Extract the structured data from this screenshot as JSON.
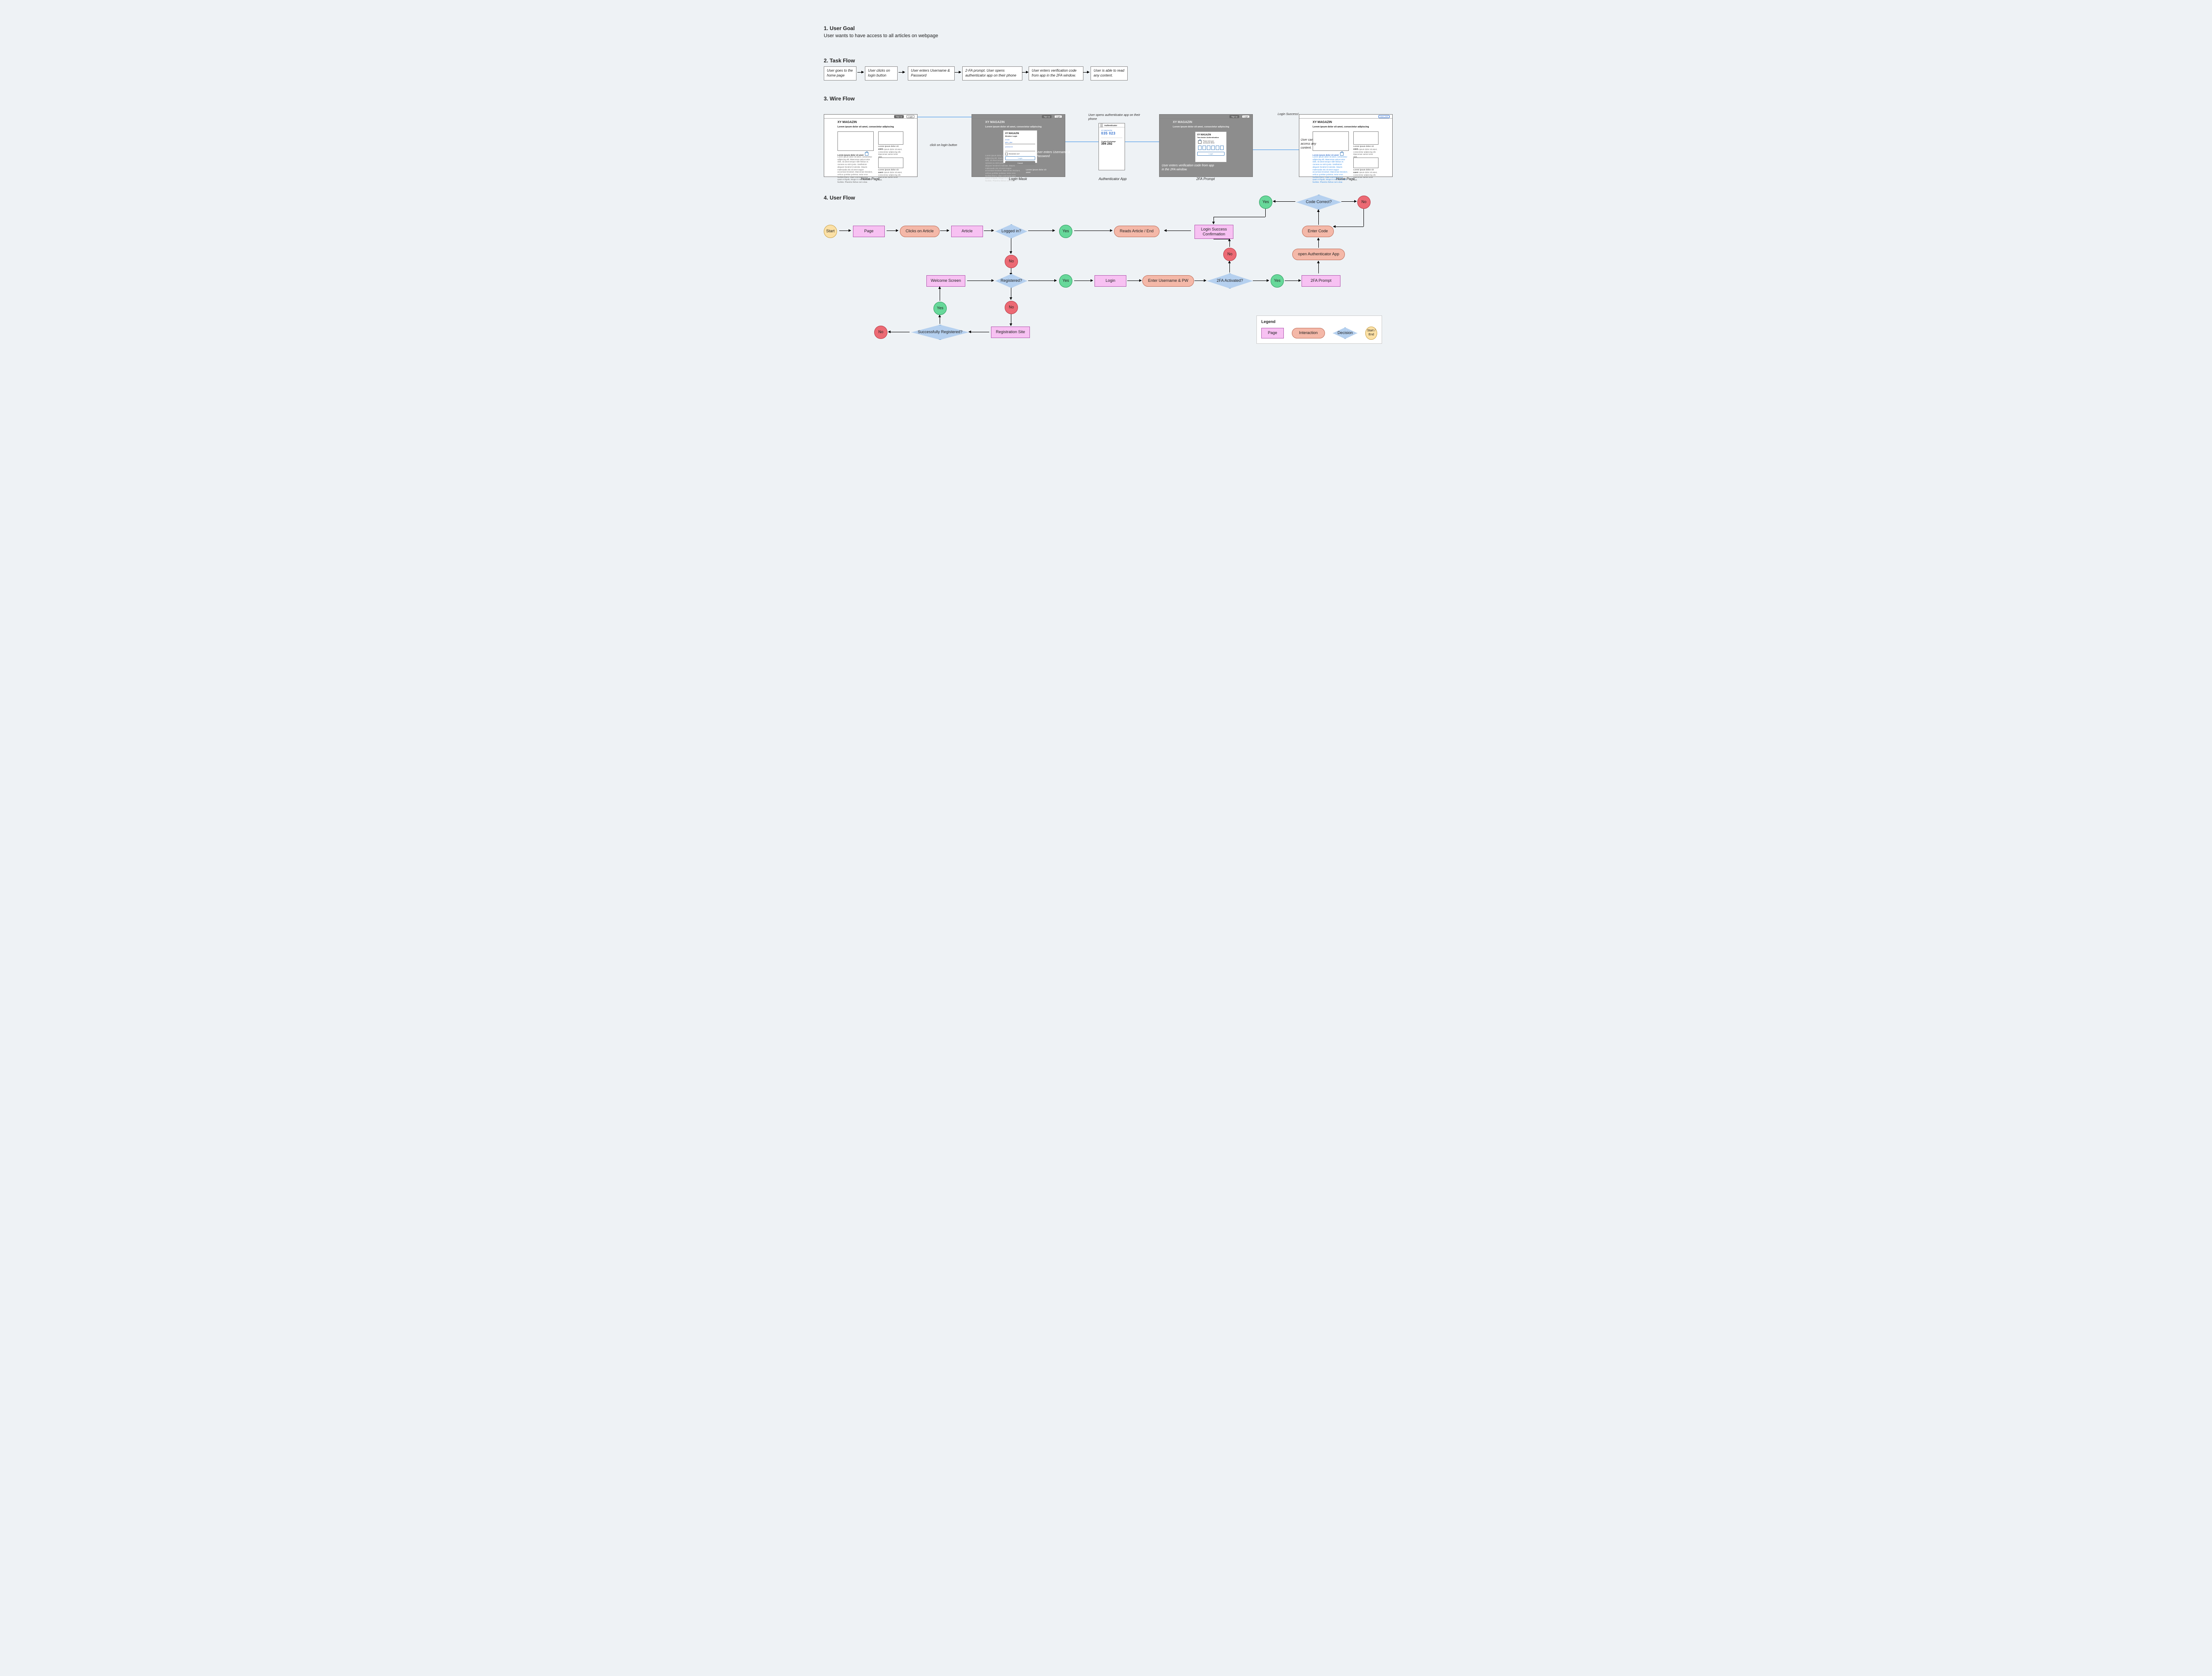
{
  "sections": {
    "s1_title": "1. User Goal",
    "s1_text": "User wants to have access to all articles on webpage",
    "s2_title": "2. Task Flow",
    "s3_title": "3. Wire Flow",
    "s4_title": "4. User Flow"
  },
  "task": {
    "t1": "User goes to the home page",
    "t2": "User clicks on login button",
    "t3": "User enters Username & Password",
    "t4": "2-FA prompt. User opens authenticator app on their phone",
    "t5": "User enters verification code from app in the 2FA window.",
    "t6": "User is able to read any content."
  },
  "wire": {
    "brand": "XY MAGAZIN",
    "headline": "Lorem ipsum dolor sit amet, consectetur adipiscing",
    "side_head": "Lorem ipsum dolor sit amet",
    "side_body": "Lorem ipsum dolor sit amet, consectetur adipiscing elit. Maecenas varius tortor nibh.",
    "locked_body": "Lorem ipsum dolor sit amet, consectetur adipiscing elit. Maecenas varius tortor nibh, sit amet tempor nibh finibus et. Aenean eu enim justo. Vestibulum aliquam hendrerit molestie. Mauris malesuada nisi sit amet augue accumsan tincidunt. Maecenas tincidunt, velit ac porttitor pulvinar, tortor eros facilisis libero, vitae commodo nunc quam et ligula, integer in nisi est iaculis facilisis. Pharetra finibus sem vitae.",
    "btn_signup": "Sign up",
    "btn_login": "Login",
    "login": {
      "title": "Member Login",
      "email_l": "email",
      "email_v": "john_doe",
      "pw_l": "password",
      "remember": "Remember me?",
      "login": "Login",
      "cancel": "Cancel"
    },
    "twofa": {
      "title": "Two-factor Authentication",
      "hint": "Please enter your accesscode below",
      "login": "Login"
    },
    "logged": {
      "user": "User_043"
    },
    "captions": {
      "c1": "Home Page",
      "c2": "Login Mask",
      "c3": "Authenticator App",
      "c4": "2FA Prompt",
      "c5": "Home Page"
    },
    "annots": {
      "a0": "click on login button",
      "a1": "User enters Username & Password",
      "a2": "User opens authenticator app on their phone",
      "a3": "User enters verification code from app in the 2FA window.",
      "a4": "Login Success!",
      "a5": "User can access  any content."
    }
  },
  "phone": {
    "app": "Authenticator",
    "acc1": "XY MAGAZIN",
    "code1": "035 023",
    "acc2": "Crypto Exchange",
    "code2": "394 292"
  },
  "flow": {
    "start": "Start",
    "page": "Page",
    "clicks": "Clicks on Article",
    "article": "Article",
    "logged": "Logged in?",
    "yes": "Yes",
    "no": "No",
    "reads": "Reads Article / End",
    "welcome": "Welcome Screen",
    "registered": "Registered?",
    "login": "Login",
    "enterup": "Enter Username & PW",
    "twofaq": "2FA Activated?",
    "twofap": "2FA Prompt",
    "openauth": "open Authenticator App",
    "entercode": "Enter Code",
    "codeok": "Code Correct?",
    "succconf": "Login Success Confirmation",
    "regsite": "Registration Site",
    "succreg": "Successfully Registered?"
  },
  "legend": {
    "title": "Legend",
    "page": "Page",
    "interaction": "Interaction",
    "decision": "Decision",
    "startend": "Start / End"
  }
}
